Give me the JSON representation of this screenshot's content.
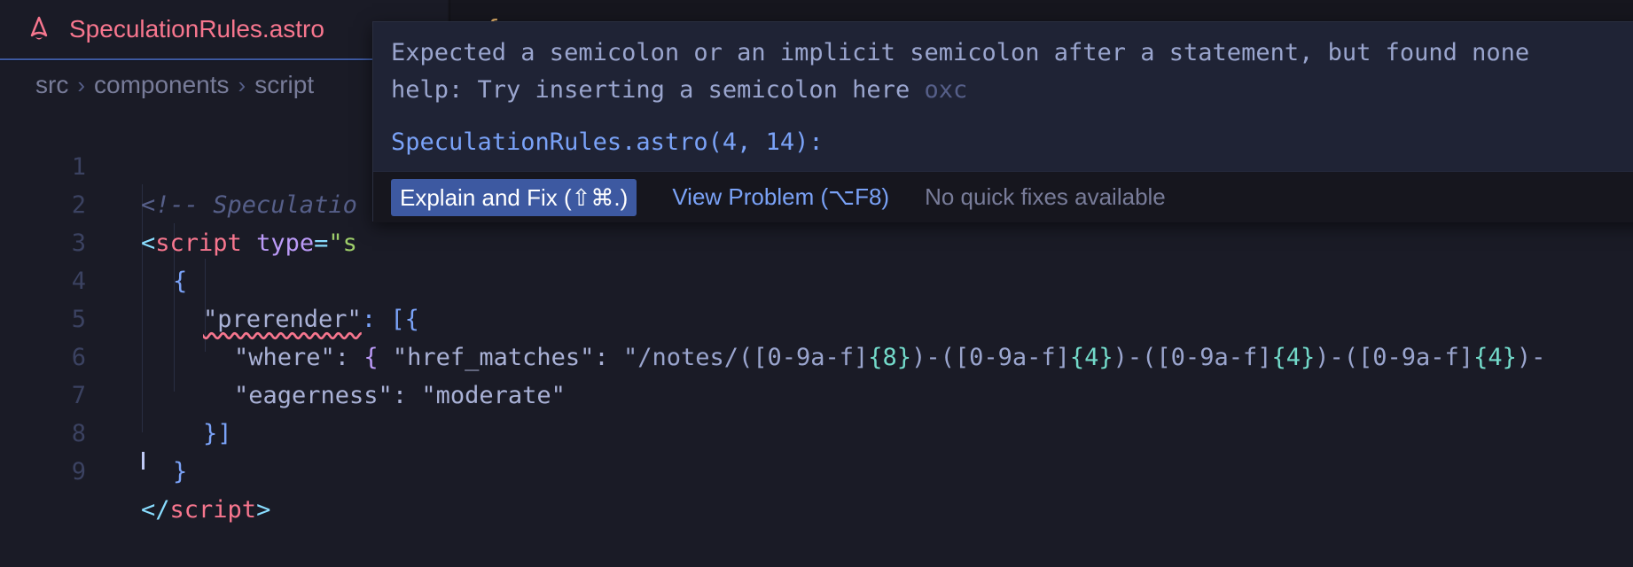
{
  "tabs": {
    "active": {
      "label": "SpeculationRules.astro",
      "icon": "astro-icon",
      "color": "#f7768e"
    },
    "second": {
      "label": ""
    }
  },
  "breadcrumb": [
    "src",
    "components",
    "script"
  ],
  "editor": {
    "line_numbers": [
      "1",
      "2",
      "3",
      "4",
      "5",
      "6",
      "7",
      "8",
      "9"
    ],
    "lines": {
      "l1": "<!-- Speculatio",
      "l2_tag_open": "<",
      "l2_tag_name": "script",
      "l2_attr": " type",
      "l2_eq": "=",
      "l2_str": "\"s",
      "l3": "{",
      "l4_key": "\"prerender\"",
      "l4_rest": ": [{",
      "l5_key": "\"where\"",
      "l5_colon": ": ",
      "l5_brace": "{",
      "l5_key2": " \"href_matches\"",
      "l5_colon2": ": ",
      "l5_regex": "\"/notes/([0-9a-f]",
      "l5_q1": "{8}",
      "l5_r2": ")-([0-9a-f]",
      "l5_q2": "{4}",
      "l5_r3": ")-([0-9a-f]",
      "l5_q3": "{4}",
      "l5_r4": ")-([0-9a-f]",
      "l5_q4": "{4}",
      "l5_r5": ")-",
      "l6_key": "\"eagerness\"",
      "l6_colon": ": ",
      "l6_val": "\"moderate\"",
      "l7": "}]",
      "l8": "}",
      "l9_open": "</",
      "l9_name": "script",
      "l9_close": ">"
    }
  },
  "hover": {
    "message_line1": "Expected a semicolon or an implicit semicolon after a statement, but found none",
    "message_line2": "help: Try inserting a semicolon here",
    "source": "oxc",
    "location": "SpeculationRules.astro(4, 14):",
    "explain_button": "Explain and Fix (⇧⌘.)",
    "view_problem": "View Problem (⌥F8)",
    "no_fixes": "No quick fixes available"
  }
}
